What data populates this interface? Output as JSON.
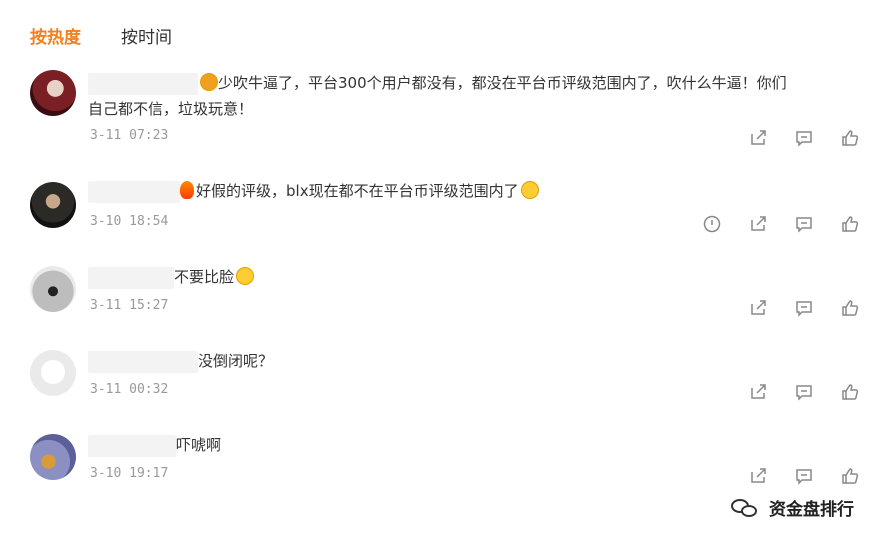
{
  "tabs": [
    {
      "label": "按热度",
      "active": true
    },
    {
      "label": "按时间",
      "active": false
    }
  ],
  "comments": [
    {
      "text1": "少吹牛逼了，平台300个用户都没有，都没在平台币评级范围内了，吹什么牛逼！你们",
      "text2": "自己都不信，垃圾玩意！",
      "time": "3-11 07:23",
      "actions": [
        "share-icon",
        "comment-icon",
        "like-icon"
      ]
    },
    {
      "text1": "好假的评级，blx现在都不在平台币评级范围内了",
      "time": "3-10 18:54",
      "actions": [
        "report-icon",
        "share-icon",
        "comment-icon",
        "like-icon"
      ]
    },
    {
      "text1": "不要比脸",
      "time": "3-11 15:27",
      "actions": [
        "share-icon",
        "comment-icon",
        "like-icon"
      ]
    },
    {
      "text1": "没倒闭呢？",
      "time": "3-11 00:32",
      "actions": [
        "share-icon",
        "comment-icon",
        "like-icon"
      ]
    },
    {
      "text1": "吓唬啊",
      "time": "3-10 19:17",
      "actions": [
        "share-icon",
        "comment-icon",
        "like-icon"
      ]
    }
  ],
  "watermark": {
    "text": "资金盘排行",
    "icon": "wechat-icon"
  },
  "colors": {
    "accent": "#f08020",
    "text": "#333333",
    "muted": "#999999",
    "icon": "#888888"
  }
}
